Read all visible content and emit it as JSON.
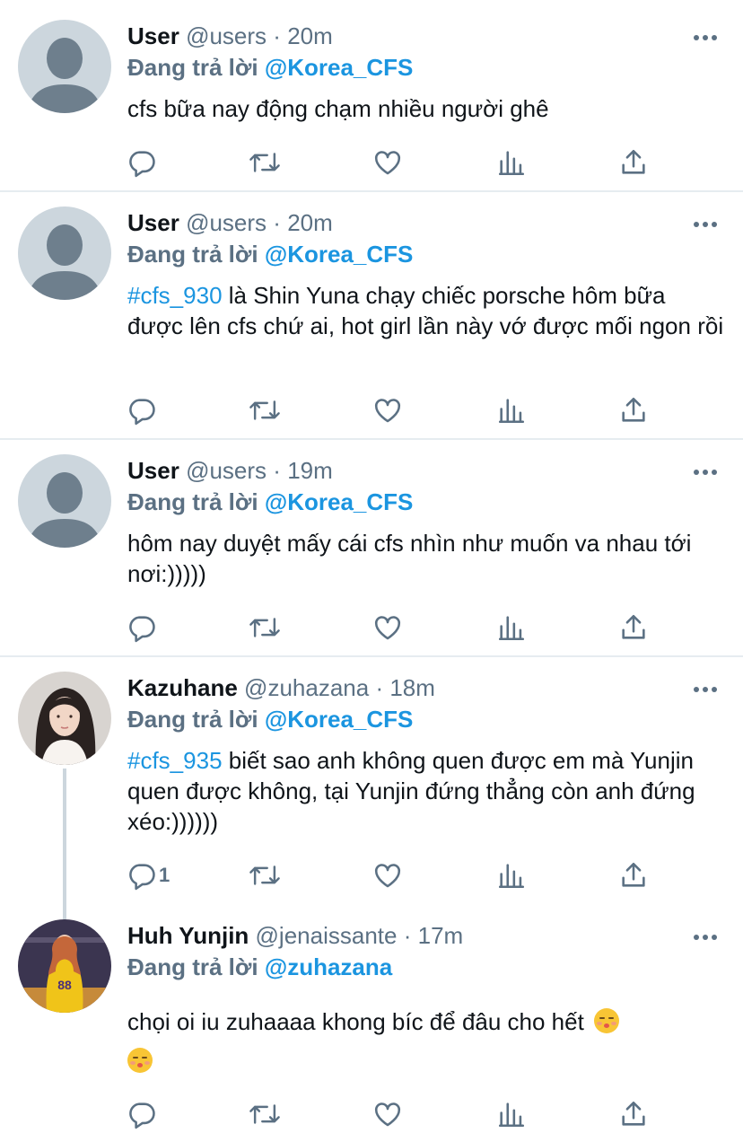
{
  "tweets": [
    {
      "name": "User",
      "handle": "@users",
      "time": "20m",
      "reply_prefix": "Đang trả lời",
      "reply_mention": "@Korea_CFS",
      "hashtag": "",
      "text": "cfs bữa nay động chạm nhiều người ghê",
      "reply_count": ""
    },
    {
      "name": "User",
      "handle": "@users",
      "time": "20m",
      "reply_prefix": "Đang trả lời",
      "reply_mention": "@Korea_CFS",
      "hashtag": "#cfs_930",
      "text": " là Shin Yuna chạy chiếc porsche hôm bữa được lên cfs chứ ai, hot girl lần này vớ được mối ngon rồi",
      "reply_count": ""
    },
    {
      "name": "User",
      "handle": "@users",
      "time": "19m",
      "reply_prefix": "Đang trả lời",
      "reply_mention": "@Korea_CFS",
      "hashtag": "",
      "text": "hôm nay duyệt mấy cái cfs nhìn như muốn va nhau tới nơi:)))))",
      "reply_count": ""
    },
    {
      "name": "Kazuhane",
      "handle": "@zuhazana",
      "time": "18m",
      "reply_prefix": "Đang trả lời",
      "reply_mention": "@Korea_CFS",
      "hashtag": "#cfs_935",
      "text": " biết sao anh không quen được em mà Yunjin quen được không, tại Yunjin đứng thẳng còn anh đứng xéo:))))))",
      "reply_count": "1"
    },
    {
      "name": "Huh Yunjin",
      "handle": "@jenaissante",
      "time": "17m",
      "reply_prefix": "Đang trả lời",
      "reply_mention": "@zuhazana",
      "hashtag": "",
      "text": "chọi oi iu zuhaaaa khong bíc để đâu cho hết",
      "reply_count": ""
    }
  ],
  "separator": "·",
  "icons": {
    "reply": "reply-icon",
    "retweet": "retweet-icon",
    "like": "heart-icon",
    "analytics": "analytics-icon",
    "share": "share-icon",
    "more": "more-icon",
    "emoji": "kissing-face-emoji"
  },
  "colors": {
    "accent": "#1b95e0",
    "muted": "#5b7083",
    "text": "#0f1419",
    "divider": "#e6ecf0"
  }
}
